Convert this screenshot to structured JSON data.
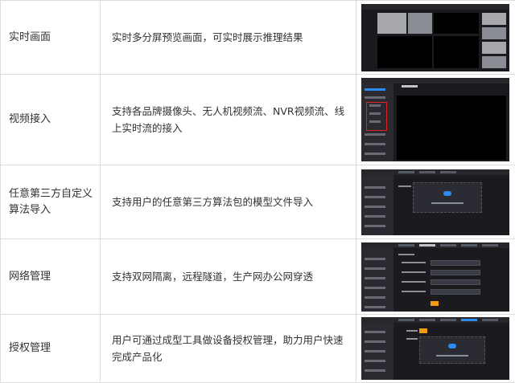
{
  "rows": [
    {
      "feature": "实时画面",
      "description": "实时多分屏预览画面，可实时展示推理结果",
      "shot_icon": "multi-screen-preview-screenshot"
    },
    {
      "feature": "视频接入",
      "description": "支持各品牌摄像头、无人机视频流、NVR视频流、线上实时流的接入",
      "shot_icon": "video-access-screenshot"
    },
    {
      "feature": "任意第三方自定义算法导入",
      "description": "支持用户的任意第三方算法包的模型文件导入",
      "shot_icon": "algorithm-import-screenshot"
    },
    {
      "feature": "网络管理",
      "description": "支持双网隔离，远程隧道，生产网办公网穿透",
      "shot_icon": "network-management-screenshot"
    },
    {
      "feature": "授权管理",
      "description": "用户可通过成型工具做设备授权管理，助力用户快速完成产品化",
      "shot_icon": "license-management-screenshot"
    }
  ],
  "colors": {
    "accent": "#2d8cf0",
    "highlight": "#e02424",
    "button": "#f39c12",
    "dark_bg": "#1b1b1f"
  }
}
